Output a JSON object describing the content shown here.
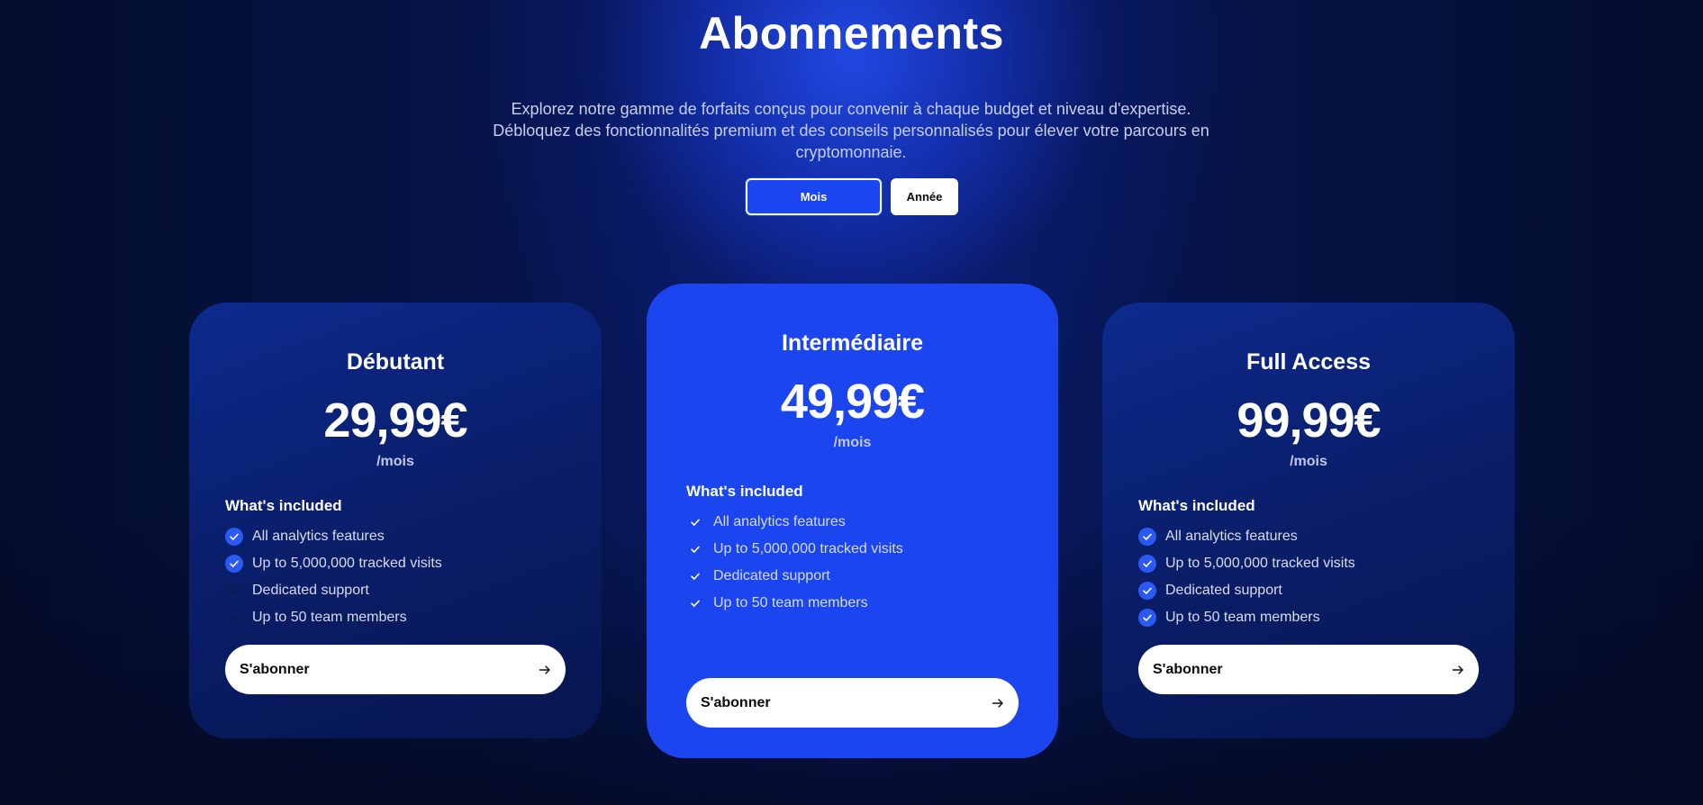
{
  "header": {
    "title": "Abonnements",
    "subtitle": "Explorez notre gamme de forfaits conçus pour convenir à chaque budget et niveau d'expertise. Débloquez des fonctionnalités premium et des conseils personnalisés pour élever votre parcours en cryptomonnaie."
  },
  "billing_toggle": {
    "monthly_label": "Mois",
    "yearly_label": "Année",
    "selected": "Mois"
  },
  "plans": [
    {
      "name": "Débutant",
      "price": "29,99€",
      "period": "/mois",
      "included_label": "What's included",
      "features": [
        {
          "label": "All analytics features",
          "included": true
        },
        {
          "label": "Up to 5,000,000 tracked visits",
          "included": true
        },
        {
          "label": "Dedicated support",
          "included": false
        },
        {
          "label": "Up to 50 team members",
          "included": false
        }
      ],
      "cta_label": "S'abonner"
    },
    {
      "name": "Intermédiaire",
      "price": "49,99€",
      "period": "/mois",
      "included_label": "What's included",
      "features": [
        {
          "label": "All analytics features",
          "included": true
        },
        {
          "label": "Up to 5,000,000 tracked visits",
          "included": true
        },
        {
          "label": "Dedicated support",
          "included": true
        },
        {
          "label": "Up to 50 team members",
          "included": true
        }
      ],
      "cta_label": "S'abonner"
    },
    {
      "name": "Full Access",
      "price": "99,99€",
      "period": "/mois",
      "included_label": "What's included",
      "features": [
        {
          "label": "All analytics features",
          "included": true
        },
        {
          "label": "Up to 5,000,000 tracked visits",
          "included": true
        },
        {
          "label": "Dedicated support",
          "included": true
        },
        {
          "label": "Up to 50 team members",
          "included": true
        }
      ],
      "cta_label": "S'abonner"
    }
  ],
  "colors": {
    "accent_blue": "#1b46ef",
    "background_dark": "#050f33",
    "check_active": "#2a59f5",
    "check_inactive": "#0b1d63"
  }
}
